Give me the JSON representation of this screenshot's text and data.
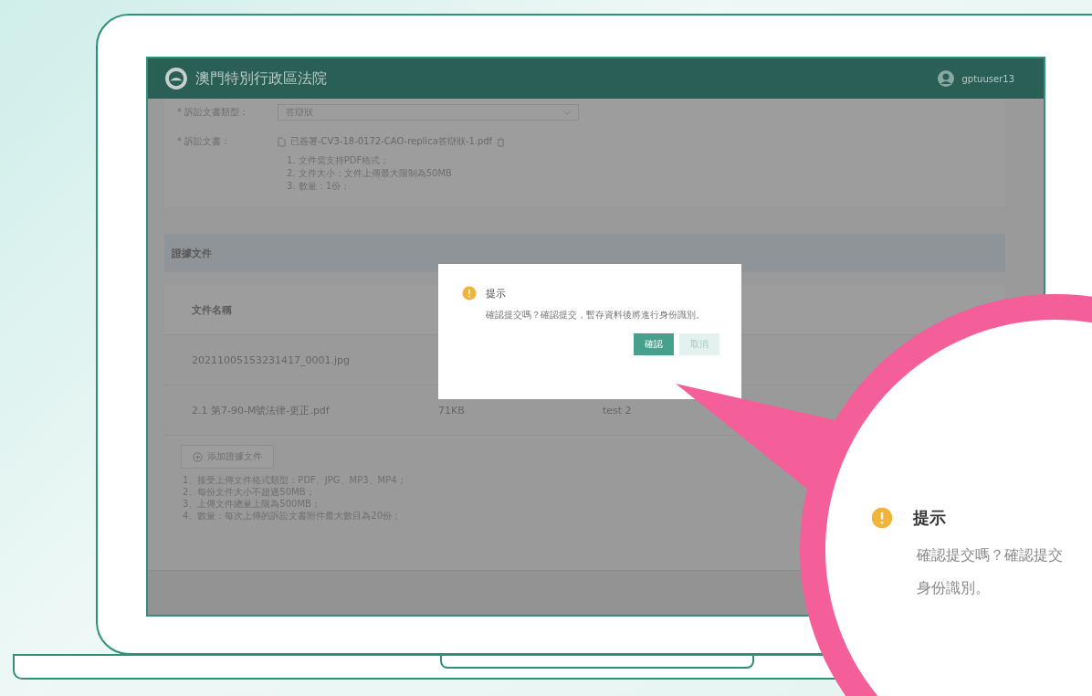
{
  "header": {
    "title": "澳門特別行政區法院",
    "username": "gptuuser13"
  },
  "form": {
    "fields": [
      {
        "kind": "select",
        "label": "* 訴訟文書類型：",
        "value": "答辯狀"
      },
      {
        "kind": "file",
        "label": "* 訴訟文書：",
        "value": "已簽署-CV3-18-0172-CAO-replica答辯狀-1.pdf",
        "notes": [
          "1. 文件需支持PDF格式；",
          "2. 文件大小：文件上傳最大限制為50MB",
          "3. 數量：1份；"
        ]
      }
    ]
  },
  "evidence": {
    "title": "證據文件",
    "columns": [
      "文件名稱"
    ],
    "rows": [
      {
        "cells": [
          "20211005153231417_0001.jpg"
        ]
      },
      {
        "cells": [
          "2.1 第7-90-M號法律-更正.pdf",
          "71KB",
          "test 2"
        ]
      }
    ],
    "add_button": "添加證據文件",
    "notes": [
      "1、接受上傳文件格式類型：PDF、JPG、MP3、MP4；",
      "2、每份文件大小不超過50MB；",
      "3、上傳文件總量上限為500MB；",
      "4、數量：每次上傳的訴訟文書附件最大數目為20份；"
    ]
  },
  "dialog": {
    "title": "提示",
    "message": "確認提交嗎？確認提交，暫存資料後將進行身份識別。",
    "buttons": [
      {
        "label": "確認",
        "kind": "primary"
      },
      {
        "label": "取消",
        "kind": "secondary"
      }
    ]
  },
  "magnifier": {
    "title": "提示",
    "lines": [
      "確認提交嗎？確認提交",
      "身份識別。"
    ]
  }
}
